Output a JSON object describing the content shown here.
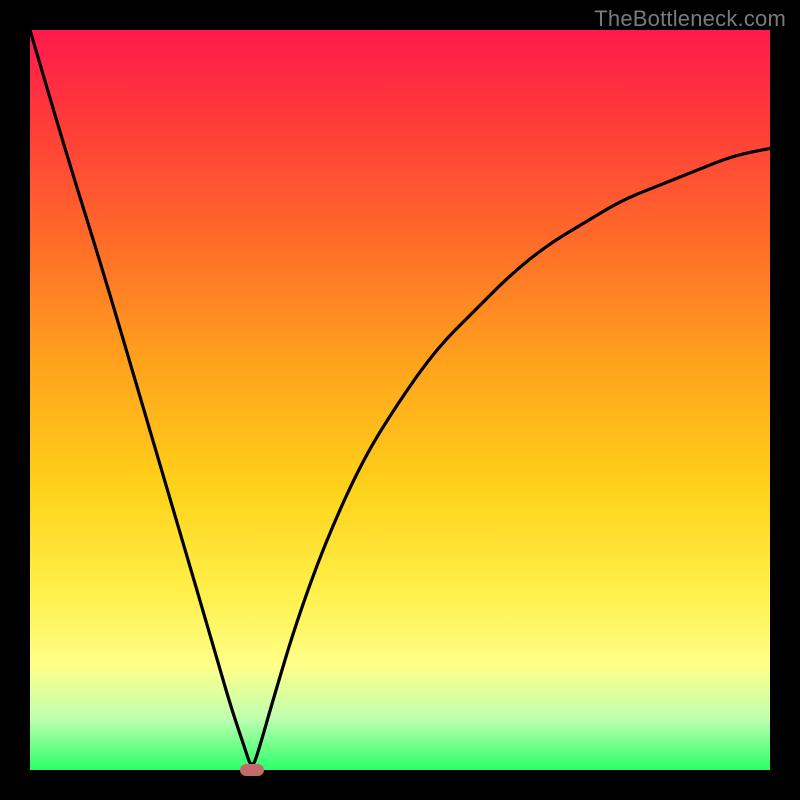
{
  "watermark": {
    "text": "TheBottleneck.com"
  },
  "chart_data": {
    "type": "line",
    "title": "",
    "xlabel": "",
    "ylabel": "",
    "xlim": [
      0,
      100
    ],
    "ylim": [
      0,
      100
    ],
    "grid": false,
    "legend": false,
    "series": [
      {
        "name": "curve",
        "x": [
          0,
          5,
          10,
          15,
          20,
          25,
          27,
          29,
          30,
          31,
          33,
          36,
          40,
          45,
          50,
          55,
          60,
          65,
          70,
          75,
          80,
          85,
          90,
          95,
          100
        ],
        "y": [
          100,
          83,
          67,
          50,
          33,
          16,
          9,
          3,
          0,
          3,
          10,
          20,
          31,
          42,
          50,
          57,
          62,
          67,
          71,
          74,
          77,
          79,
          81,
          83,
          84
        ]
      }
    ],
    "marker": {
      "x": 30,
      "y": 0,
      "color": "#c46a6a"
    },
    "background_gradient": {
      "top": "#ff1a4d",
      "bottom": "#2aff6a"
    }
  }
}
